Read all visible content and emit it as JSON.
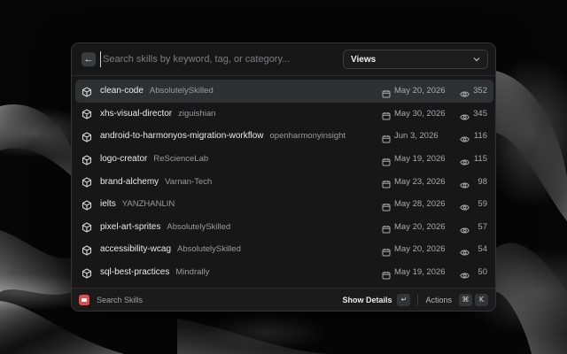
{
  "search": {
    "placeholder": "Search skills by keyword, tag, or category...",
    "value": "",
    "sort_selected": "Views"
  },
  "icons": {
    "back": "arrow-left-icon",
    "sort": "chevron-down-icon",
    "item": "cube-icon",
    "date": "calendar-icon",
    "views": "eye-icon"
  },
  "skills": [
    {
      "name": "clean-code",
      "author": "AbsolutelySkilled",
      "date": "May 20, 2026",
      "views": "352"
    },
    {
      "name": "xhs-visual-director",
      "author": "ziguishian",
      "date": "May 30, 2026",
      "views": "345"
    },
    {
      "name": "android-to-harmonyos-migration-workflow",
      "author": "openharmonyinsight",
      "date": "Jun 3, 2026",
      "views": "116"
    },
    {
      "name": "logo-creator",
      "author": "ReScienceLab",
      "date": "May 19, 2026",
      "views": "115"
    },
    {
      "name": "brand-alchemy",
      "author": "Varnan-Tech",
      "date": "May 23, 2026",
      "views": "98"
    },
    {
      "name": "ielts",
      "author": "YANZHANLIN",
      "date": "May 28, 2026",
      "views": "59"
    },
    {
      "name": "pixel-art-sprites",
      "author": "AbsolutelySkilled",
      "date": "May 20, 2026",
      "views": "57"
    },
    {
      "name": "accessibility-wcag",
      "author": "AbsolutelySkilled",
      "date": "May 20, 2026",
      "views": "54"
    },
    {
      "name": "sql-best-practices",
      "author": "Mindrally",
      "date": "May 19, 2026",
      "views": "50"
    }
  ],
  "footer": {
    "app_name": "Search Skills",
    "show_details": "Show Details",
    "enter_key": "↵",
    "actions": "Actions",
    "cmd_key": "⌘",
    "k_key": "K"
  },
  "colors": {
    "accent_app_icon": "#e24c4c",
    "selected_row": "#2f3032",
    "panel": "#181819"
  }
}
